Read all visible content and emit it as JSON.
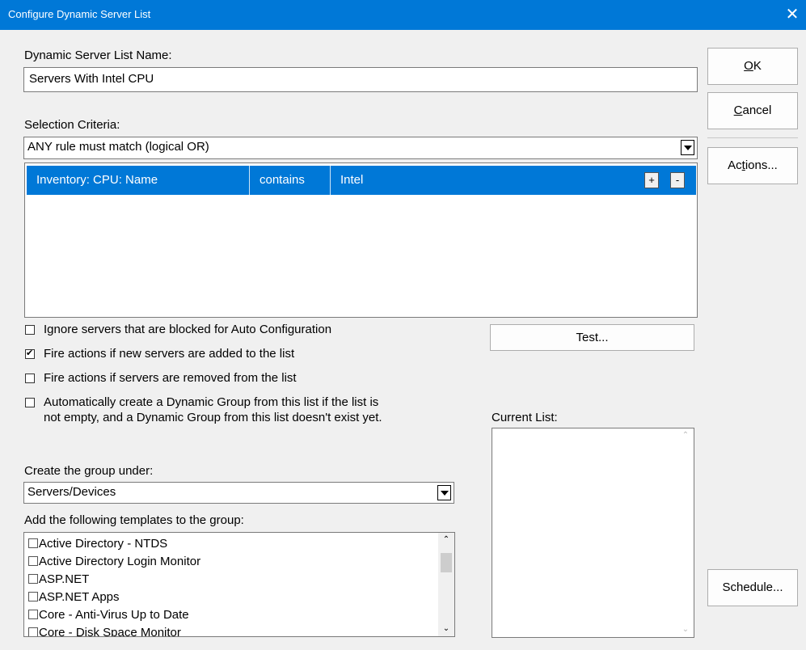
{
  "window": {
    "title": "Configure Dynamic Server List",
    "close_glyph": "✕"
  },
  "name_field": {
    "label": "Dynamic Server List Name:",
    "value": "Servers With Intel CPU"
  },
  "selection": {
    "label": "Selection Criteria:",
    "value": "ANY rule must match (logical OR)",
    "rules": [
      {
        "field": "Inventory: CPU: Name",
        "operator": "contains",
        "value": "Intel"
      }
    ],
    "add_label": "+",
    "remove_label": "-"
  },
  "options": [
    {
      "label": "Ignore servers that are blocked for Auto Configuration",
      "checked": false
    },
    {
      "label": "Fire actions if new servers are added to the list",
      "checked": true
    },
    {
      "label": "Fire actions if servers are removed from the list",
      "checked": false
    },
    {
      "label_line1": "Automatically create a Dynamic Group from this list if the list is",
      "label_line2": "not empty, and a Dynamic Group from this list doesn't exist yet.",
      "checked": false
    }
  ],
  "group": {
    "label": "Create the group under:",
    "value": "Servers/Devices"
  },
  "templates": {
    "label": "Add the following templates to the group:",
    "items": [
      "Active Directory - NTDS",
      "Active Directory Login Monitor",
      "ASP.NET",
      "ASP.NET Apps",
      "Core - Anti-Virus Up to Date",
      "Core - Disk Space Monitor"
    ]
  },
  "current_list": {
    "label": "Current List:"
  },
  "buttons": {
    "test": "Test...",
    "ok_mnemonic": "O",
    "ok_rest": "K",
    "cancel_mnemonic": "C",
    "cancel_rest": "ancel",
    "actions_pre": "Ac",
    "actions_mnemonic": "t",
    "actions_post": "ions...",
    "schedule": "Schedule..."
  },
  "icons": {
    "scroll_up": "⌃",
    "scroll_down": "⌄"
  },
  "colors": {
    "titlebar": "#0078d7",
    "selection": "#0078d7",
    "background": "#f0f0f0"
  }
}
